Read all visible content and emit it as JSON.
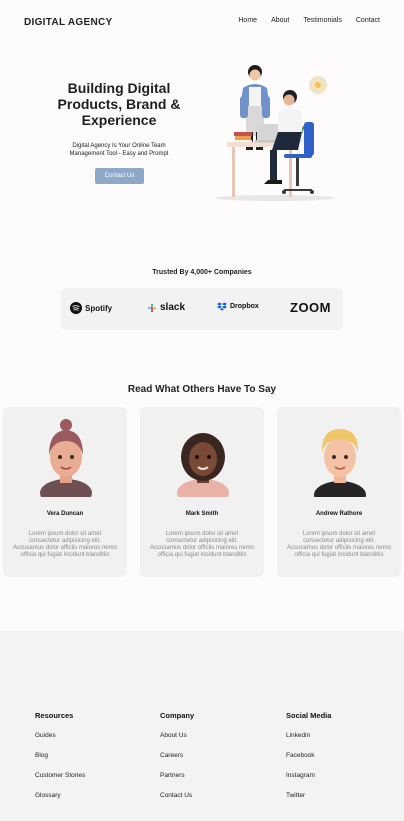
{
  "header": {
    "logo": "DIGITAL AGENCY",
    "nav": [
      "Home",
      "About",
      "Testimonials",
      "Contact"
    ]
  },
  "hero": {
    "title": "Building Digital Products, Brand & Experience",
    "subtitle": "Digital Agency Is Your Online Team Management Tool - Easy and Prompt",
    "cta": "Contact Us"
  },
  "trusted": {
    "title": "Trusted By 4,000+ Companies",
    "brands": [
      "Spotify",
      "slack",
      "Dropbox",
      "zoom"
    ]
  },
  "testimonials": {
    "title": "Read What Others Have To Say",
    "items": [
      {
        "name": "Vera Duncan",
        "text": "Lorem ipsum dolor sit amet consectetur adipisicing elit. Accusamus dolor officiis maiores nemo officia qui fugiat incidunt blanditiis"
      },
      {
        "name": "Mark Smith",
        "text": "Lorem ipsum dolor sit amet consectetur adipisicing elit. Accusamus dolor officiis maiores nemo officia qui fugiat incidunt blanditiis"
      },
      {
        "name": "Andrew Rathore",
        "text": "Lorem ipsum dolor sit amet consectetur adipisicing elit. Accusamus dolor officiis maiores nemo officia qui fugiat incidunt blanditiis"
      }
    ]
  },
  "footer": {
    "columns": [
      {
        "title": "Resources",
        "links": [
          "Guides",
          "Blog",
          "Customer Stories",
          "Glossary"
        ]
      },
      {
        "title": "Company",
        "links": [
          "About Us",
          "Careers",
          "Partners",
          "Contact Us"
        ]
      },
      {
        "title": "Social Media",
        "links": [
          "Linkedin",
          "Facebook",
          "Instagram",
          "Twitter"
        ]
      }
    ]
  },
  "colors": {
    "accent": "#8fa8c8",
    "page_bg": "#fdfbfb",
    "card_bg": "#f2f1f1",
    "footer_bg": "#f3f3f3"
  }
}
